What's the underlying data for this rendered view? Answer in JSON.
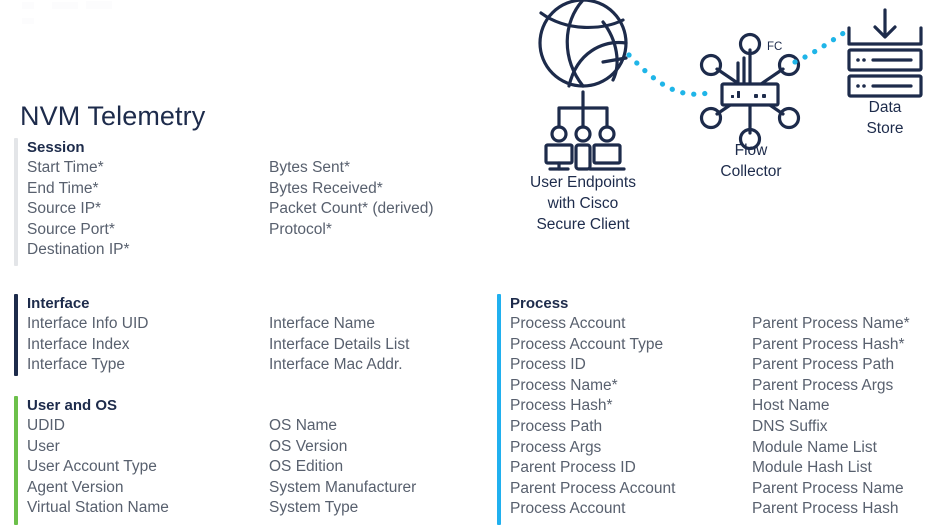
{
  "title": "NVM Telemetry",
  "colors": {
    "title_navy": "#1d2b4b",
    "field_gray": "#58606e",
    "session_bar": "#e3e5e8",
    "interface_bar": "#1d2b4b",
    "user_os_bar": "#6cc04a",
    "process_bar": "#20b0ef",
    "dotted_link": "#1fb5e8",
    "icon_navy": "#1d2b4b"
  },
  "sections": [
    {
      "id": "session",
      "title": "Session",
      "bar_color": "#e3e5e8",
      "col1": [
        "Start Time*",
        "End Time*",
        "Source IP*",
        "Source Port*",
        "Destination IP*"
      ],
      "col2": [
        "Bytes Sent*",
        "Bytes Received*",
        "Packet Count* (derived)",
        "Protocol*"
      ]
    },
    {
      "id": "interface",
      "title": "Interface",
      "bar_color": "#1d2b4b",
      "col1": [
        "Interface Info UID",
        "Interface Index",
        "Interface Type"
      ],
      "col2": [
        "Interface Name",
        "Interface Details List",
        "Interface Mac Addr."
      ]
    },
    {
      "id": "user-and-os",
      "title": "User and OS",
      "bar_color": "#6cc04a",
      "col1": [
        "UDID",
        "User",
        "User Account Type",
        "Agent Version",
        "Virtual Station Name"
      ],
      "col2": [
        "OS Name",
        "OS Version",
        "OS Edition",
        "System Manufacturer",
        "System Type"
      ]
    },
    {
      "id": "process",
      "title": "Process",
      "bar_color": "#20b0ef",
      "col1": [
        "Process Account",
        "Process Account Type",
        "Process ID",
        "Process Name*",
        "Process Hash*",
        "Process Path",
        "Process Args",
        "Parent Process ID",
        "Parent Process Account",
        "Process Account"
      ],
      "col2": [
        "Parent Process Name*",
        "Parent Process Hash*",
        "Parent Process Path",
        "Parent Process Args",
        "Host Name",
        "DNS Suffix",
        "Module Name List",
        "Module Hash List",
        "Parent Process Name",
        "Parent Process Hash"
      ]
    }
  ],
  "diagram": {
    "nodes": [
      {
        "id": "user-endpoints",
        "caption": "User Endpoints\nwith Cisco\nSecure Client",
        "icon": "globe-and-devices-icon"
      },
      {
        "id": "flow-collector",
        "caption": "Flow\nCollector",
        "icon": "flow-collector-icon",
        "badge": "FC"
      },
      {
        "id": "data-store",
        "caption": "Data\nStore",
        "icon": "data-store-icon"
      }
    ],
    "links": [
      {
        "from": "user-endpoints",
        "to": "flow-collector",
        "style": "dotted"
      },
      {
        "from": "flow-collector",
        "to": "data-store",
        "style": "dotted"
      }
    ]
  }
}
